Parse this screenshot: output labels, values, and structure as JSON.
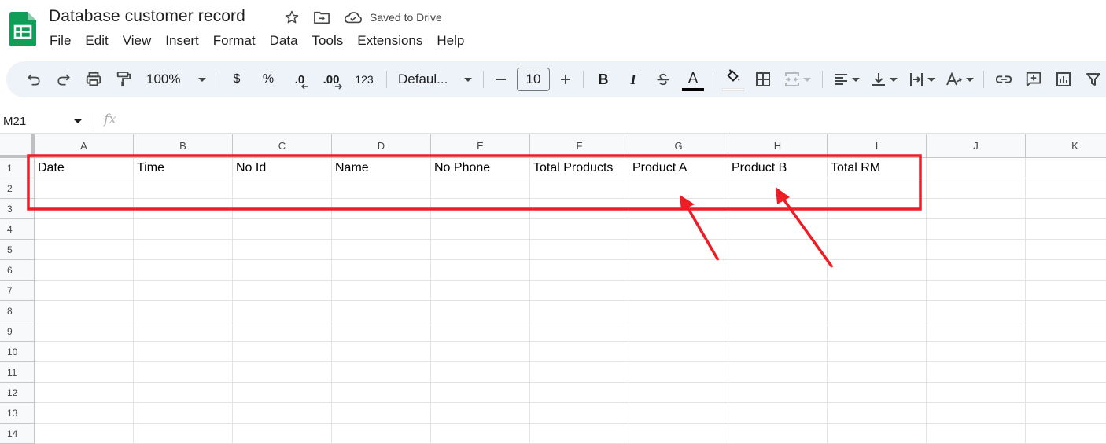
{
  "document": {
    "title": "Database customer record",
    "save_status": "Saved to Drive"
  },
  "menu": [
    "File",
    "Edit",
    "View",
    "Insert",
    "Format",
    "Data",
    "Tools",
    "Extensions",
    "Help"
  ],
  "toolbar": {
    "zoom": "100%",
    "currency": "$",
    "percent": "%",
    "decrease_decimal": ".0",
    "increase_decimal": ".00",
    "more_formats": "123",
    "font": "Defaul...",
    "font_size": "10",
    "bold": "B",
    "italic": "I",
    "text_color_letter": "A",
    "text_color": "#000000"
  },
  "formula_bar": {
    "name_box": "M21",
    "fx": "fx"
  },
  "sheet": {
    "columns": [
      "A",
      "B",
      "C",
      "D",
      "E",
      "F",
      "G",
      "H",
      "I",
      "J",
      "K"
    ],
    "rows": [
      "1",
      "2",
      "3",
      "4",
      "5",
      "6",
      "7",
      "8",
      "9",
      "10",
      "11",
      "12",
      "13",
      "14"
    ],
    "header_row": [
      "Date",
      "Time",
      "No Id",
      "Name",
      "No Phone",
      "Total Products",
      "Product A",
      "Product B",
      "Total RM"
    ]
  },
  "annotation": {
    "color": "#ee1c25"
  }
}
